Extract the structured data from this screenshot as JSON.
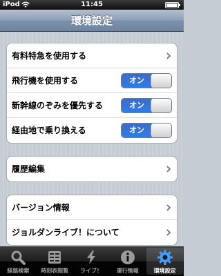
{
  "status_bar": {
    "carrier": "iPod",
    "time": "11:45"
  },
  "nav": {
    "title": "環境設定"
  },
  "groups": [
    {
      "rows": [
        {
          "label": "有料特急を使用する",
          "type": "disclosure"
        },
        {
          "label": "飛行機を使用する",
          "type": "toggle",
          "value": "オン"
        },
        {
          "label": "新幹線のぞみを優先する",
          "type": "toggle",
          "value": "オン"
        },
        {
          "label": "経由地で乗り換える",
          "type": "toggle",
          "value": "オン"
        }
      ]
    },
    {
      "rows": [
        {
          "label": "履歴編集",
          "type": "disclosure"
        }
      ]
    },
    {
      "rows": [
        {
          "label": "バージョン情報",
          "type": "disclosure"
        },
        {
          "label": "ジョルダンライブ！について",
          "type": "disclosure"
        }
      ]
    }
  ],
  "tabs": [
    {
      "label": "経路検索",
      "icon": "magnifier-icon",
      "active": false
    },
    {
      "label": "時刻表閲覧",
      "icon": "timetable-icon",
      "active": false
    },
    {
      "label": "ライブ！",
      "icon": "lightning-icon",
      "active": false
    },
    {
      "label": "運行情報",
      "icon": "info-icon",
      "active": false
    },
    {
      "label": "環境設定",
      "icon": "gear-icon",
      "active": true
    }
  ],
  "colors": {
    "toggle_on": "#2f7de5",
    "nav_bar": "#7d91a9",
    "background": "#c5ccd4"
  }
}
